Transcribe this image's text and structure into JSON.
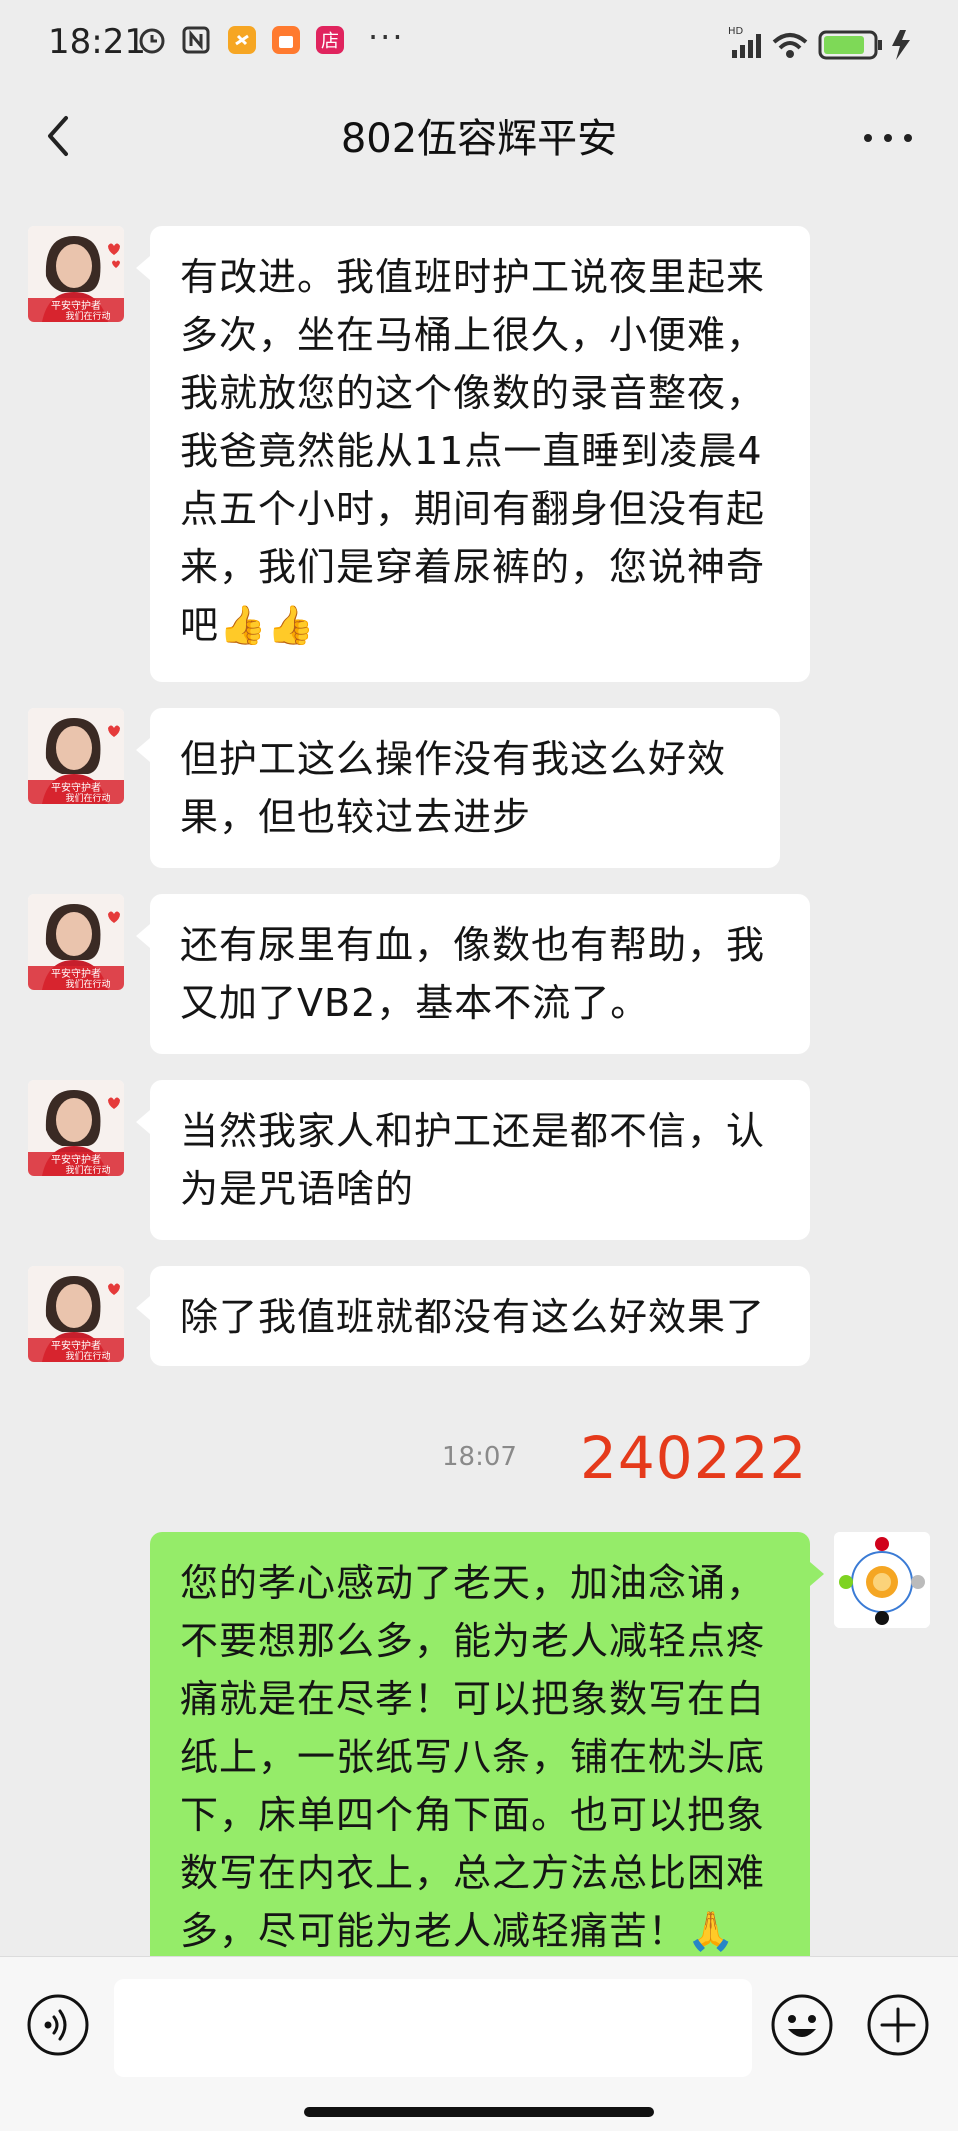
{
  "status_bar": {
    "time": "18:21",
    "network": "HD",
    "battery": "73",
    "icons": [
      "alarm-icon",
      "nfc-icon",
      "app-icon",
      "shopping-icon",
      "store-icon"
    ],
    "more": "···"
  },
  "header": {
    "title": "802伍容辉平安",
    "back_icon": "chevron-left-icon",
    "more_icon": "more-dots-icon"
  },
  "messages": [
    {
      "sender": "other",
      "lines": [
        "有改进。我值班时护工说夜里起来",
        "多次，坐在马桶上很久，小便难，",
        "我就放您的这个像数的录音整夜，",
        "我爸竟然能从11点一直睡到凌晨4",
        "点五个小时，期间有翻身但没有起",
        "来，我们是穿着尿裤的，您说神奇",
        "吧👍👍"
      ]
    },
    {
      "sender": "other",
      "lines": [
        "但护工这么操作没有我这么好效",
        "果，但也较过去进步"
      ]
    },
    {
      "sender": "other",
      "lines": [
        "还有尿里有血，像数也有帮助，我",
        "又加了VB2，基本不流了。"
      ]
    },
    {
      "sender": "other",
      "lines": [
        "当然我家人和护工还是都不信，认",
        "为是咒语啥的"
      ]
    },
    {
      "sender": "other",
      "lines": [
        "除了我值班就都没有这么好效果了"
      ]
    },
    {
      "sender": "me",
      "lines": [
        "您的孝心感动了老天，加油念诵，",
        "不要想那么多，能为老人减轻点疼",
        "痛就是在尽孝！可以把象数写在白",
        "纸上，一张纸写八条，铺在枕头底",
        "下，床单四个角下面。也可以把象",
        "数写在内衣上，总之方法总比困难",
        "多，尽可能为老人减轻痛苦！🙏"
      ]
    }
  ],
  "avatar_text": {
    "line1": "平安守护者",
    "line2": "我们在行动"
  },
  "time_label": "18:07",
  "stamp": "240222",
  "input_bar": {
    "voice_icon": "voice-icon",
    "emoji_icon": "emoji-icon",
    "plus_icon": "plus-icon",
    "placeholder": ""
  },
  "colors": {
    "background": "#ededed",
    "my_bubble": "#95ec69",
    "stamp": "#e53a1b"
  }
}
